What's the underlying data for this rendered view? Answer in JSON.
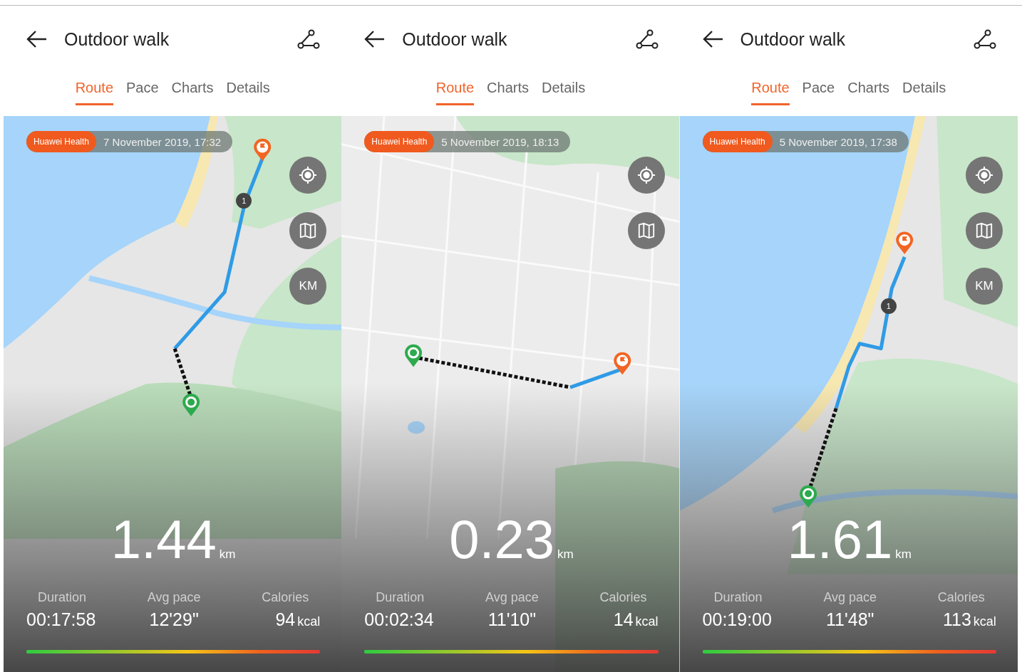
{
  "screens": [
    {
      "title": "Outdoor walk",
      "tabs": [
        {
          "label": "Route",
          "selected": true
        },
        {
          "label": "Pace",
          "selected": false
        },
        {
          "label": "Charts",
          "selected": false
        },
        {
          "label": "Details",
          "selected": false
        }
      ],
      "map": {
        "kind": "coast",
        "source": "Huawei Health",
        "date": "7 November 2019, 17:32",
        "km_marker": "1",
        "buttons": [
          {
            "kind": "locate"
          },
          {
            "kind": "layers"
          },
          {
            "kind": "units",
            "label": "KM"
          }
        ]
      },
      "distance": {
        "value": "1.44",
        "unit": "km"
      },
      "stats": [
        {
          "label": "Duration",
          "value": "00:17:58"
        },
        {
          "label": "Avg pace",
          "value": "12'29\""
        },
        {
          "label": "Calories",
          "value": "94",
          "unit": "kcal"
        }
      ]
    },
    {
      "title": "Outdoor walk",
      "tabs": [
        {
          "label": "Route",
          "selected": true
        },
        {
          "label": "Charts",
          "selected": false
        },
        {
          "label": "Details",
          "selected": false
        }
      ],
      "map": {
        "kind": "streets",
        "source": "Huawei Health",
        "date": "5 November 2019, 18:13",
        "buttons": [
          {
            "kind": "locate"
          },
          {
            "kind": "layers"
          }
        ]
      },
      "distance": {
        "value": "0.23",
        "unit": "km"
      },
      "stats": [
        {
          "label": "Duration",
          "value": "00:02:34"
        },
        {
          "label": "Avg pace",
          "value": "11'10\""
        },
        {
          "label": "Calories",
          "value": "14",
          "unit": "kcal"
        }
      ]
    },
    {
      "title": "Outdoor walk",
      "tabs": [
        {
          "label": "Route",
          "selected": true
        },
        {
          "label": "Pace",
          "selected": false
        },
        {
          "label": "Charts",
          "selected": false
        },
        {
          "label": "Details",
          "selected": false
        }
      ],
      "map": {
        "kind": "bay",
        "source": "Huawei Health",
        "date": "5 November 2019, 17:38",
        "km_marker": "1",
        "buttons": [
          {
            "kind": "locate"
          },
          {
            "kind": "layers"
          },
          {
            "kind": "units",
            "label": "KM"
          }
        ]
      },
      "distance": {
        "value": "1.61",
        "unit": "km"
      },
      "stats": [
        {
          "label": "Duration",
          "value": "00:19:00"
        },
        {
          "label": "Avg pace",
          "value": "11'48\""
        },
        {
          "label": "Calories",
          "value": "113",
          "unit": "kcal"
        }
      ]
    }
  ]
}
